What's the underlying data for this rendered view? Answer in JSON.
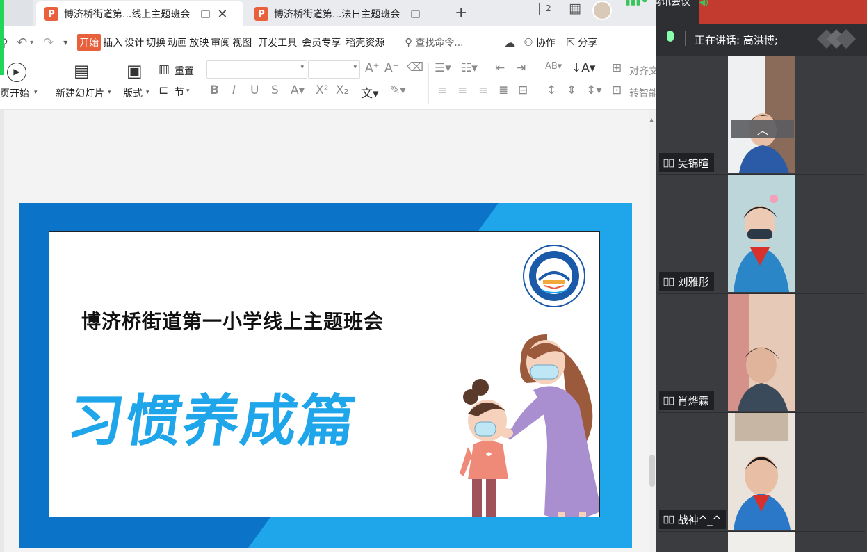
{
  "tabs": [
    {
      "label": "博济桥街道第...线上主题班会",
      "active": true,
      "icon": "P"
    },
    {
      "label": "博济桥街道第...法日主题班会",
      "active": false,
      "icon": "P"
    }
  ],
  "titlebar": {
    "layout_badge": "2",
    "add_tab": "+"
  },
  "menu": {
    "items": [
      "开始",
      "插入",
      "设计",
      "切换",
      "动画",
      "放映",
      "审阅",
      "视图",
      "开发工具",
      "会员专享",
      "稻壳资源"
    ],
    "search_placeholder": "查找命令...",
    "collab": "协作",
    "share": "分享"
  },
  "ribbon": {
    "from_start": "页开始",
    "new_slide": "新建幻灯片",
    "layout": "版式",
    "reset": "重置",
    "section": "节",
    "align_text": "对齐文",
    "convert_smart": "转智能"
  },
  "slide": {
    "school_title": "博济桥街道第一小学线上主题班会",
    "main_title": "习惯养成篇",
    "logo_text": "博济桥街道第一小学"
  },
  "meeting": {
    "app_name": "腾讯会议",
    "speaking": "正在讲话: 高洪博;",
    "participants": [
      {
        "name": "吴锦暄",
        "muted": true
      },
      {
        "name": "刘雅彤",
        "muted": true
      },
      {
        "name": "肖烨霖",
        "muted": true
      },
      {
        "name": "战神^_^",
        "muted": true
      }
    ]
  },
  "colors": {
    "accent": "#e8603c",
    "slide_blue": "#0b73c8",
    "slide_cyan": "#1ea5ea",
    "panel_bg": "#3b3d41"
  }
}
